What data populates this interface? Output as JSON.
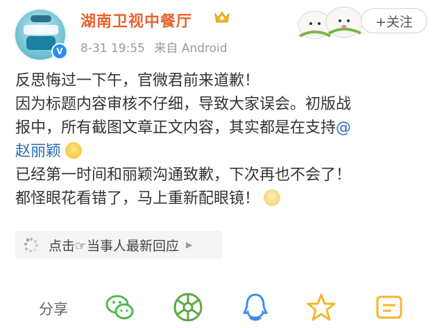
{
  "header": {
    "account_name": "湖南卫视中餐厅",
    "timestamp": "8-31 19:55",
    "source": "来自 Android",
    "follow_label": "+关注"
  },
  "post": {
    "line1": "反思悔过一下午，官微君前来道歉！",
    "line2": "因为标题内容审核不仔细，导致大家误会。初版战",
    "line3_text": "报中，所有截图文章正文内容，其实都是在支持",
    "line3_at": "@",
    "line4_mention": "赵丽颖",
    "line5": "已经第一时间和丽颖沟通致歉，下次再也不会了！",
    "line6": "都怪眼花看错了，马上重新配眼镜！"
  },
  "reply_prompt": {
    "label": "点击☞当事人最新回应"
  },
  "share": {
    "label": "分享"
  },
  "colors": {
    "account_name": "#e8612c",
    "mention": "#2b6cb5",
    "meta": "#9a9a9a",
    "wechat": "#4cb94d",
    "moments": "#5aa845",
    "qq": "#3f8ee6",
    "favorite": "#f3b629"
  }
}
